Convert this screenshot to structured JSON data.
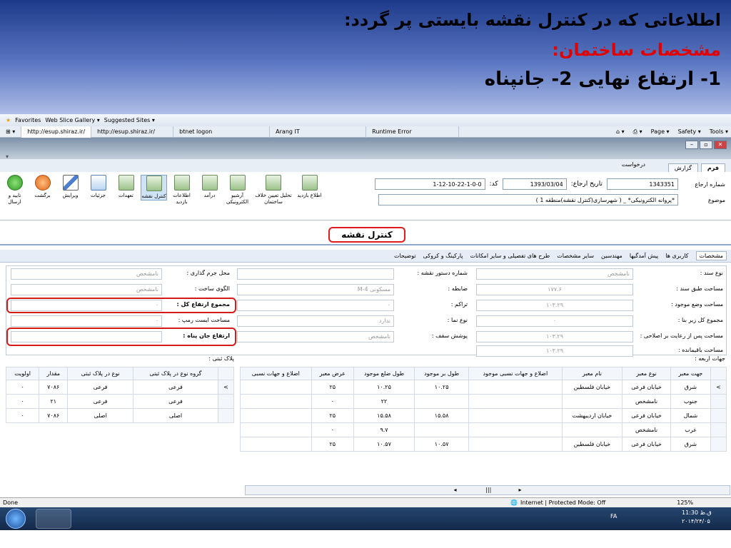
{
  "banner": {
    "line1": "اطلاعاتی که در کنترل نقشه بایستی پر گردد:",
    "line2": "مشخصات ساختمان:",
    "line3": "1- ارتفاع نهایی  2- جانپناه"
  },
  "browser": {
    "favorites": "Favorites",
    "web_slice": "Web Slice Gallery ▾",
    "suggested": "Suggested Sites ▾",
    "tabs": [
      "http://esup.shiraz.ir/",
      "http://esup.shiraz.ir/",
      "btnet logon",
      "Arang IT",
      "Runtime Error"
    ],
    "menu": [
      "Page ▾",
      "Safety ▾",
      "Tools ▾"
    ],
    "status_left": "Done",
    "status_zone": "Internet | Protected Mode: Off",
    "zoom": "125%"
  },
  "app": {
    "main_tabs": [
      "فرم",
      "گزارش",
      "درخواست"
    ],
    "fields": {
      "case_number_label": "شماره ارجاع",
      "case_number": "1343351",
      "date_label": "تاریخ ارجاع:",
      "date": "1393/03/04",
      "code_label": "کد:",
      "code": "1-12-10-22-1-0-0",
      "subject_label": "موضوع",
      "subject": "*پروانه الکترونیکی* _ ( شهرسازی(کنترل نقشه)منطقه 1 )"
    },
    "tools": [
      "تایید و ارسال",
      "برگشت",
      "ویرایش",
      "جزئیات",
      "تعهدات",
      "کنترل نقشه",
      "اطلاعات بازدید",
      "درآمد",
      "آرشیو الکترونیکی",
      "تحلیل تعیین خلاف ساختمان",
      "اطلاع بازدید"
    ],
    "section_title": "کنترل نقشه",
    "subtabs": [
      "مشخصات",
      "کاربری ها",
      "پیش آمدگیها",
      "مهندسین",
      "سایر مشخصات",
      "طرح های تفصیلی و سایر امکانات",
      "پارکینگ و کروکی",
      "توضیحات"
    ],
    "form": {
      "doc_type_label": "نوع سند :",
      "doc_type": "نامشخص",
      "area_doc_label": "مساحت طبق سند :",
      "area_doc": "۱۷۷.۶",
      "area_now_label": "مساحت وضع موجود :",
      "area_now": "۱۰۳.۲۹",
      "total_base_label": "مجموع کل زیر بنا :",
      "total_base": "۰",
      "area_after_label": "مساحت پس از رعایت بر اصلاحی :",
      "area_after": "۱۰۳.۲۹",
      "area_remain_label": "مساحت باقیمانده :",
      "area_remain": "۱۰۳.۲۹",
      "plan_no_label": "شماره دستور نقشه :",
      "plan_no": "",
      "criterion_label": "ضابطه :",
      "criterion": "مسکونی M-4",
      "density_label": "تراکم :",
      "density": "۰",
      "facade_label": "نوع نما :",
      "facade": "ندارد",
      "roof_label": "پوشش سقف :",
      "roof": "نامشخص",
      "penalty_label": "محل جرم گذاری :",
      "penalty": "نامشخص",
      "pattern_label": "الگوی ساخت :",
      "pattern": "نامشخص",
      "total_height_label": "مجموع ارتفاع کل :",
      "total_height": "۰",
      "ramp_label": "مساحت ایست رمپ :",
      "ramp": "۰",
      "parapet_label": "ارتفاع جان پناه :",
      "parapet": ""
    },
    "directions_title": "جهات اربعه :",
    "plaque_title": "پلاک ثبتی :",
    "dir_headers": [
      "جهت معبر",
      "نوع معبر",
      "نام معبر",
      "اضلاع و جهات نسبی موجود",
      "طول بر موجود",
      "طول ضلع موجود",
      "عرض معبر",
      "اضلاع و جهات نسبی"
    ],
    "dir_rows": [
      [
        "شرق",
        "خیابان فرعی",
        "خیابان فلسطین",
        "",
        "۱۰.۲۵",
        "۱۰.۲۵",
        "۲۵",
        ""
      ],
      [
        "جنوب",
        "نامشخص",
        "",
        "",
        "",
        "۲۲",
        "۰",
        ""
      ],
      [
        "شمال",
        "خیابان فرعی",
        "خیابان اردیبهشت",
        "",
        "۱۵.۵۸",
        "۱۵.۵۸",
        "۲۵",
        ""
      ],
      [
        "غرب",
        "نامشخص",
        "",
        "",
        "",
        "۹.۷",
        "۰",
        ""
      ],
      [
        "شرق",
        "خیابان فرعی",
        "خیابان فلسطین",
        "",
        "۱۰.۵۷",
        "۱۰.۵۷",
        "۲۵",
        ""
      ]
    ],
    "plaque_headers": [
      "گروه نوع در پلاک ثبتی",
      "نوع در پلاک ثبتی",
      "مقدار",
      "اولویت"
    ],
    "plaque_rows": [
      [
        "فرعی",
        "فرعی",
        "۷۰۸۶",
        "۰"
      ],
      [
        "فرعی",
        "فرعی",
        "۲۱",
        "۰"
      ],
      [
        "اصلی",
        "اصلی",
        "۷۰۸۶",
        "۰"
      ]
    ]
  },
  "taskbar": {
    "lang": "FA",
    "time": "11:30 ق.ظ",
    "date": "۲۰۱۴/۲۴/۰۵"
  }
}
